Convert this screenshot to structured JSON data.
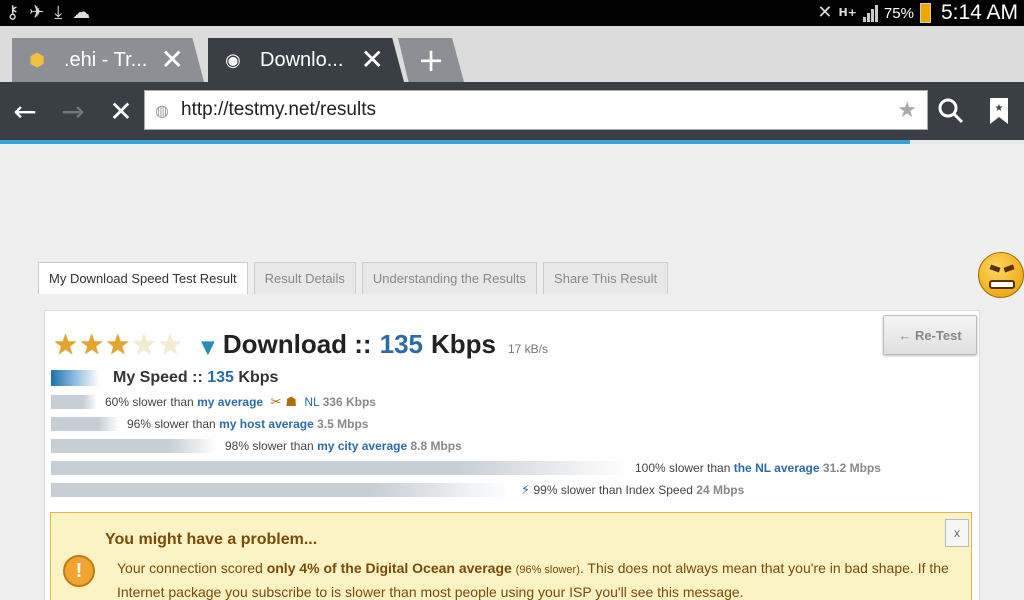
{
  "status_bar": {
    "battery": "75%",
    "time": "5:14 AM",
    "network": "H+"
  },
  "tabs": [
    {
      "title": ".ehi - Tr..."
    },
    {
      "title": "Downlo..."
    }
  ],
  "toolbar": {
    "url": "http://testmy.net/results"
  },
  "page": {
    "tabs": [
      "My Download Speed Test Result",
      "Result Details",
      "Understanding the Results",
      "Share This Result"
    ],
    "rating": {
      "filled": 3,
      "total": 5
    },
    "headline": {
      "label": "Download ::",
      "value": "135",
      "unit": "Kbps",
      "secondary": "17 kB/s"
    },
    "retest_label": "← Re-Test",
    "my_speed": {
      "label": "My Speed ::",
      "value": "135",
      "unit": "Kbps"
    },
    "comparisons": [
      {
        "text": "60% slower than",
        "link": "my average",
        "extra": "NL",
        "value": "336 Kbps"
      },
      {
        "text": "96% slower than",
        "link": "my host average",
        "extra": "",
        "value": "3.5 Mbps"
      },
      {
        "text": "98% slower than",
        "link": "my city average",
        "extra": "",
        "value": "8.8 Mbps"
      },
      {
        "text": "100% slower than",
        "link": "the NL average",
        "extra": "",
        "value": "31.2 Mbps"
      },
      {
        "text": "99% slower than Index Speed",
        "link": "",
        "extra": "",
        "value": "24 Mbps"
      }
    ],
    "alert": {
      "title": "You might have a problem...",
      "close": "x",
      "prefix": "Your connection scored",
      "bold": "only 4% of the Digital Ocean average",
      "small": "(96% slower)",
      "rest": ". This does not always mean that you're in bad shape. If the Internet package you subscribe to is slower than most people using your ISP you'll see this message."
    }
  },
  "colors": {
    "link": "#2b6ca6",
    "toolbar": "#3a3f45",
    "progress": "#3aa0d8",
    "alert_bg": "#fcf3c4",
    "star": "#e4a52a"
  }
}
